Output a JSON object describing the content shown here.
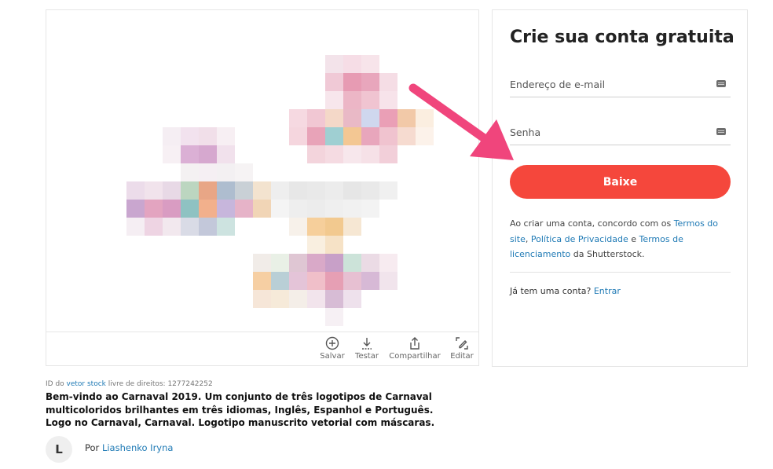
{
  "toolbar": {
    "save_label": "Salvar",
    "test_label": "Testar",
    "share_label": "Compartilhar",
    "edit_label": "Editar"
  },
  "signup": {
    "title": "Crie sua conta gratuita",
    "email_placeholder": "Endereço de e-mail",
    "password_placeholder": "Senha",
    "download_button": "Baixe",
    "terms_prefix": "Ao criar uma conta, concordo com os ",
    "terms_link_1": "Termos do site",
    "terms_sep": ", ",
    "privacy_link": "Política de Privacidade",
    "terms_and": " e ",
    "terms_link_2": "Termos de licenciamento",
    "terms_suffix": " da Shutterstock.",
    "have_account": "Já tem uma conta? ",
    "login_link": "Entrar",
    "button_color": "#f5473c"
  },
  "asset": {
    "id_prefix": "ID do ",
    "id_link": "vetor stock",
    "id_suffix": " livre de direitos: 1277242252",
    "description": "Bem-vindo ao Carnaval 2019. Um conjunto de três logotipos de Carnaval multicoloridos brilhantes em três idiomas, Inglês, Espanhol e Português. Logo no Carnaval, Carnaval. Logotipo manuscrito vetorial com máscaras.",
    "author_initial": "L",
    "author_prefix": "Por ",
    "author_name": "Liashenko Iryna"
  },
  "annotation": {
    "arrow_color": "#f0457c"
  }
}
